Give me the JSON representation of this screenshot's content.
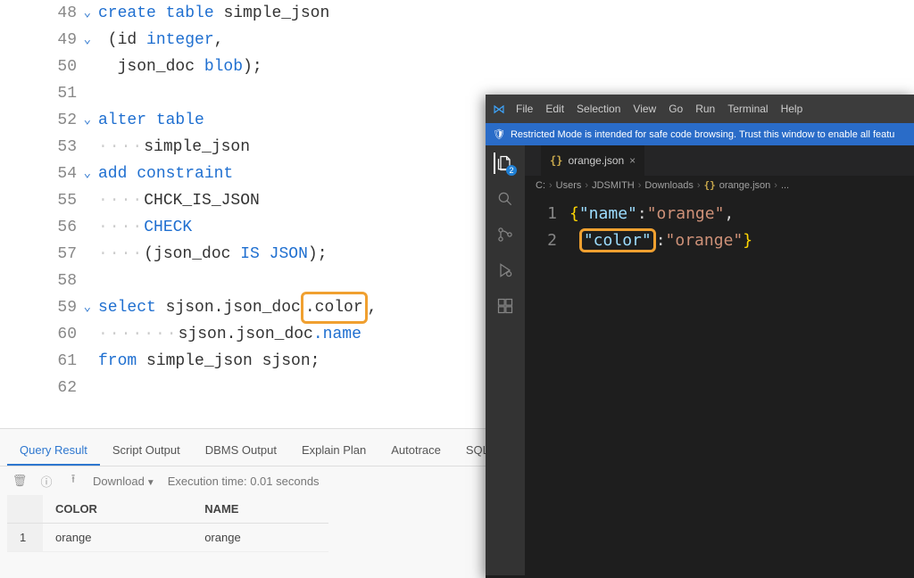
{
  "sql": {
    "lines": [
      {
        "num": 48,
        "chev": true,
        "tokens": [
          {
            "t": "create",
            "c": "kw"
          },
          {
            "t": " ",
            "c": ""
          },
          {
            "t": "table",
            "c": "kw"
          },
          {
            "t": " simple_json",
            "c": "ident"
          }
        ]
      },
      {
        "num": 49,
        "chev": true,
        "tokens": [
          {
            "t": " (",
            "c": "ident"
          },
          {
            "t": "id",
            "c": "ident"
          },
          {
            "t": " ",
            "c": ""
          },
          {
            "t": "integer",
            "c": "kw"
          },
          {
            "t": ",",
            "c": ""
          }
        ]
      },
      {
        "num": 50,
        "chev": false,
        "tokens": [
          {
            "t": "  json_doc ",
            "c": "ident"
          },
          {
            "t": "blob",
            "c": "kw"
          },
          {
            "t": ");",
            "c": ""
          }
        ]
      },
      {
        "num": 51,
        "chev": false,
        "tokens": []
      },
      {
        "num": 52,
        "chev": true,
        "tokens": [
          {
            "t": "alter",
            "c": "kw"
          },
          {
            "t": " ",
            "c": ""
          },
          {
            "t": "table",
            "c": "kw"
          }
        ]
      },
      {
        "num": 53,
        "chev": false,
        "dots": "····",
        "tokens": [
          {
            "t": "simple_json",
            "c": "ident"
          }
        ]
      },
      {
        "num": 54,
        "chev": true,
        "tokens": [
          {
            "t": "add",
            "c": "kw"
          },
          {
            "t": " ",
            "c": ""
          },
          {
            "t": "constraint",
            "c": "kw"
          }
        ]
      },
      {
        "num": 55,
        "chev": false,
        "dots": "····",
        "tokens": [
          {
            "t": "CHCK_IS_JSON",
            "c": "ident"
          }
        ]
      },
      {
        "num": 56,
        "chev": false,
        "dots": "····",
        "tokens": [
          {
            "t": "CHECK",
            "c": "kw"
          }
        ]
      },
      {
        "num": 57,
        "chev": false,
        "dots": "····",
        "tokens": [
          {
            "t": "(json_doc ",
            "c": "ident"
          },
          {
            "t": "IS",
            "c": "kw"
          },
          {
            "t": " ",
            "c": ""
          },
          {
            "t": "JSON",
            "c": "kw"
          },
          {
            "t": ");",
            "c": ""
          }
        ]
      },
      {
        "num": 58,
        "chev": false,
        "tokens": []
      },
      {
        "num": 59,
        "chev": true,
        "tokens": [
          {
            "t": "select",
            "c": "kw"
          },
          {
            "t": " sjson.json_doc",
            "c": "ident"
          },
          {
            "t": ".color",
            "c": "ident",
            "hi": true
          },
          {
            "t": ",",
            "c": ""
          }
        ]
      },
      {
        "num": 60,
        "chev": false,
        "dots": "·······",
        "tokens": [
          {
            "t": "sjson.json_doc",
            "c": "ident"
          },
          {
            "t": ".name",
            "c": "kw"
          }
        ]
      },
      {
        "num": 61,
        "chev": false,
        "tokens": [
          {
            "t": "from",
            "c": "kw"
          },
          {
            "t": " simple_json sjson;",
            "c": "ident"
          }
        ]
      },
      {
        "num": 62,
        "chev": false,
        "tokens": []
      }
    ]
  },
  "results": {
    "tabs": [
      "Query Result",
      "Script Output",
      "DBMS Output",
      "Explain Plan",
      "Autotrace",
      "SQL H"
    ],
    "active_tab": 0,
    "download_label": "Download",
    "execution_time": "Execution time: 0.01 seconds",
    "columns": [
      "COLOR",
      "NAME"
    ],
    "rows": [
      {
        "n": "1",
        "cells": [
          "orange",
          "orange"
        ]
      }
    ]
  },
  "vscode": {
    "menus": [
      "File",
      "Edit",
      "Selection",
      "View",
      "Go",
      "Run",
      "Terminal",
      "Help"
    ],
    "notice": "Restricted Mode is intended for safe code browsing. Trust this window to enable all featu",
    "badge": "2",
    "tab": {
      "file": "orange.json"
    },
    "breadcrumbs": [
      "C:",
      "Users",
      "JDSMITH",
      "Downloads",
      "orange.json",
      "..."
    ],
    "code": {
      "line1_key": "\"name\"",
      "line1_val": "\"orange\"",
      "line2_key": "\"color\"",
      "line2_val": "\"orange\""
    }
  }
}
